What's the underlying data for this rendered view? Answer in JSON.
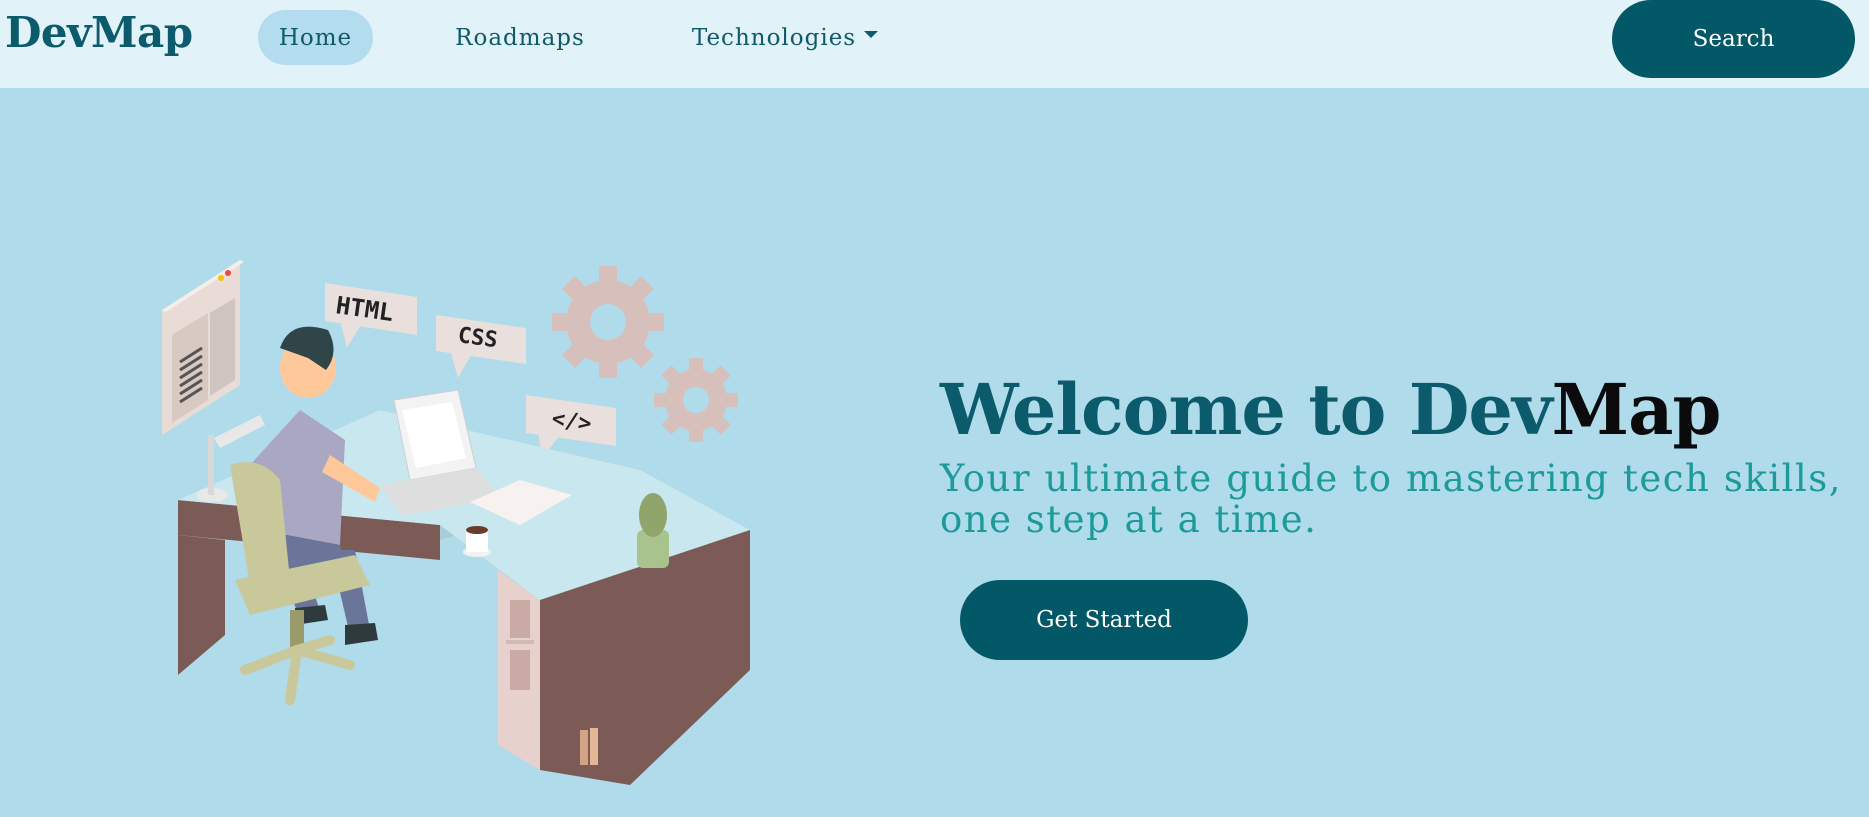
{
  "nav": {
    "brand": "DevMap",
    "items": [
      {
        "label": "Home",
        "active": true
      },
      {
        "label": "Roadmaps"
      },
      {
        "label": "Technologies"
      }
    ],
    "search_label": "Search"
  },
  "hero": {
    "title_part1": "Welcome to Dev",
    "title_part2": "Map",
    "subtitle": "Your ultimate guide to mastering tech skills, one step at a time.",
    "cta_label": "Get Started"
  },
  "illustration": {
    "bubbles": [
      "HTML",
      "CSS",
      "</>"
    ]
  },
  "colors": {
    "page_bg": "#b0dbeb",
    "nav_bg": "#e1f2f9",
    "primary": "#035868",
    "title": "#0c5b6c",
    "subtitle": "#1d9a9a"
  }
}
